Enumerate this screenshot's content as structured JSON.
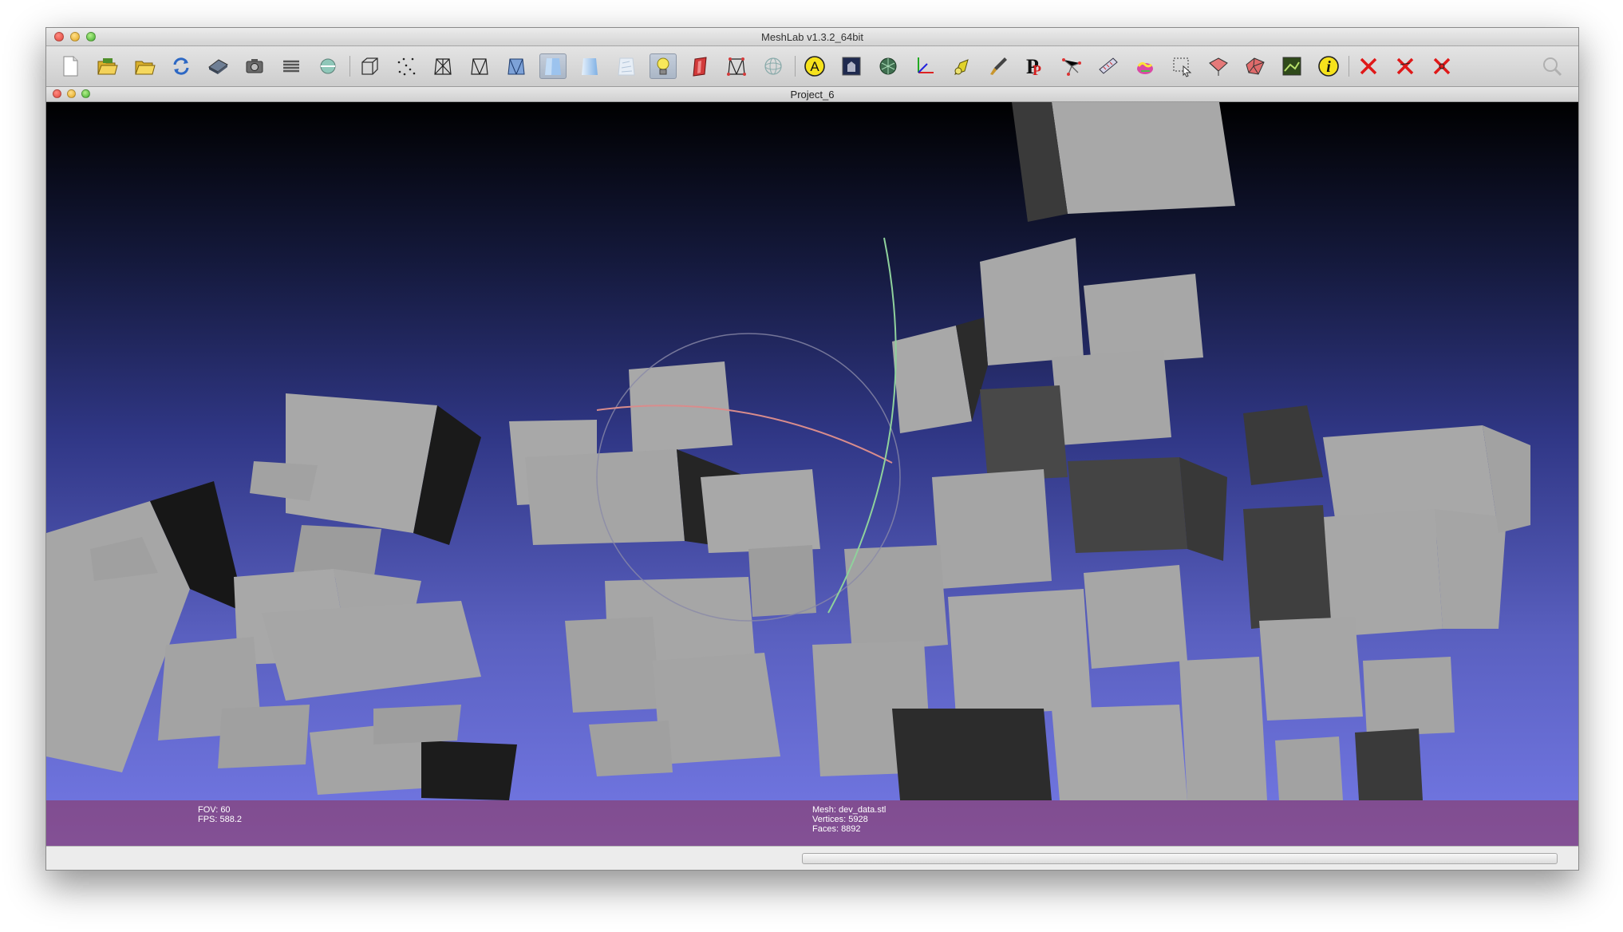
{
  "window": {
    "title": "MeshLab v1.3.2_64bit"
  },
  "document": {
    "title": "Project_6"
  },
  "toolbar": {
    "icons": [
      "new-project-icon",
      "open-project-icon",
      "open-mesh-icon",
      "reload-icon",
      "save-icon",
      "snapshot-icon",
      "layers-icon",
      "sphere-render-icon",
      "bounding-box-icon",
      "points-icon",
      "wireframe-icon",
      "hidden-lines-icon",
      "flat-lines-icon",
      "flat-shading-icon",
      "smooth-shading-icon",
      "texture-shading-icon",
      "light-icon",
      "face-normals-icon",
      "vertex-normals-icon",
      "trackball-icon",
      "annotate-icon",
      "photo-align-icon",
      "sphere-texture-icon",
      "axis-icon",
      "align-icon",
      "paint-icon",
      "pick-points-icon",
      "measure-icon",
      "select-vertices-icon",
      "color-mesh-icon",
      "select-region-icon",
      "select-faces-icon",
      "select-connected-icon",
      "image-icon",
      "info-icon",
      "delete-faces-icon",
      "delete-vertices-icon",
      "delete-selection-icon",
      "search-icon"
    ],
    "annotate_glyph": "A",
    "info_glyph": "i",
    "parameter_glyph": "P"
  },
  "overlay": {
    "fov_label": "FOV: 60",
    "fps_label": "FPS:   588.2",
    "mesh_label": "Mesh: dev_data.stl",
    "vertices_label": "Vertices: 5928",
    "faces_label": "Faces: 8892"
  },
  "colors": {
    "cube_face": "#a8a8a8",
    "cube_side": "#4a4a4a",
    "cube_shadow": "#111111",
    "overlay_bar": "#96324a",
    "trackball_red": "#d98c8c",
    "trackball_green": "#8fd19c",
    "trackball_gray": "#8a8aa8"
  }
}
